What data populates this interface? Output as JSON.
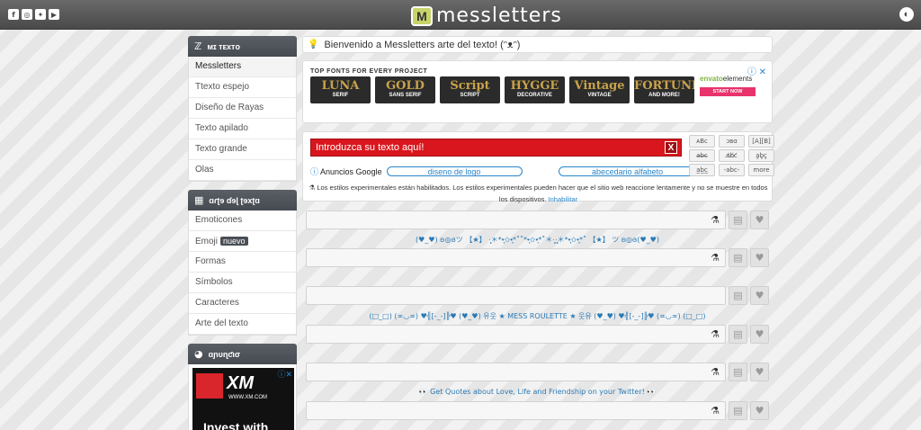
{
  "header": {
    "logo_mark": "M",
    "logo_text": "messletters",
    "social": [
      {
        "icon": "facebook-icon",
        "glyph": "f"
      },
      {
        "icon": "instagram-icon",
        "glyph": "◎"
      },
      {
        "icon": "twitter-icon",
        "glyph": "✦"
      },
      {
        "icon": "youtube-icon",
        "glyph": "▶"
      }
    ],
    "globe_glyph": "◐"
  },
  "sidebar": {
    "mi_texto": {
      "title": "ᴍɪ ᴛᴇxᴛᴏ",
      "icon_glyph": "ℤ",
      "items": [
        "Messletters",
        "Ttexto espejo",
        "Diseño de Rayas",
        "Texto apilado",
        "Texto grande",
        "Olas"
      ]
    },
    "arte": {
      "title": "ɑɾʈɘ ɗɘɭ ʈɘxʈɑ",
      "icon_glyph": "▦",
      "items": [
        "Emoticones",
        "Emoji",
        "Formas",
        "Símbolos",
        "Caracteres",
        "Arte del texto"
      ],
      "emoji_badge": "nuevo"
    },
    "anuncio": {
      "title": "ɑɲυɳƈισ",
      "icon_glyph": "◕",
      "ad_logo": "XM",
      "ad_url": "WWW.XM.COM",
      "ad_text": "Invest with"
    }
  },
  "main": {
    "welcome": "Bienvenido a Messletters arte del texto! (ᵔᴥᵔ)",
    "ad": {
      "title": "TOP FONTS FOR EVERY PROJECT",
      "tiles": [
        {
          "label": "SERIF",
          "deco": "LUNA"
        },
        {
          "label": "SANS SERIF",
          "deco": "GOLD"
        },
        {
          "label": "SCRIPT",
          "deco": "Script"
        },
        {
          "label": "DECORATIVE",
          "deco": "HYGGE"
        },
        {
          "label": "VINTAGE",
          "deco": "Vintage"
        },
        {
          "label": "AND MORE!",
          "deco": "FORTUNE"
        }
      ],
      "envato_brand": "envato",
      "envato_suffix": "elements",
      "cta": "START NOW"
    },
    "editor": {
      "input_placeholder": "Introduzca su texto aquí!",
      "clear": "X",
      "ads_label": "Anuncios Google",
      "ads_link_1": "diseno de logo",
      "ads_link_2": "abecedario alfabeto",
      "style_buttons": [
        "ᴀBc",
        "ɔʙɑ",
        "[A][B]",
        "a̶b̶c̶",
        "a̸b̸c̸",
        "a͇b͇c͇",
        "a̲b̲c̲",
        "-abc-",
        "more"
      ],
      "notice": "Los estilos experimentales están habilitados. Los estilos experimentales pueden hacer que el sitio web reaccione lentamente y no se muestre en todos los dispositivos.",
      "notice_link": "Inhabilitar"
    },
    "deco_lines": [
      "(♥_♥) ʚ◎ɞツ 【★】 ·̩̩̥͙＊*•̩̩͙✩•̩̩͙*˚˚*•̩̩͙✩•̩̩͙*˚＊·̩̩̥͙·̩̩̥͙＊*•̩̩͙✩•̩̩͙*˚ 【★】 ツ ʚ◎ɞ(♥_♥)",
      "(□_□) (≖◡≖) ♥╣[-_-]╠♥ (♥_♥) 유웃 ★ MESS ROULETTE ★ 웃유 (♥_♥) ♥╣[-_-]╠♥ (≖◡≖) (□_□)",
      "👀 Get Quotes about Love, Life and Friendship on your Twitter! 👀"
    ]
  }
}
